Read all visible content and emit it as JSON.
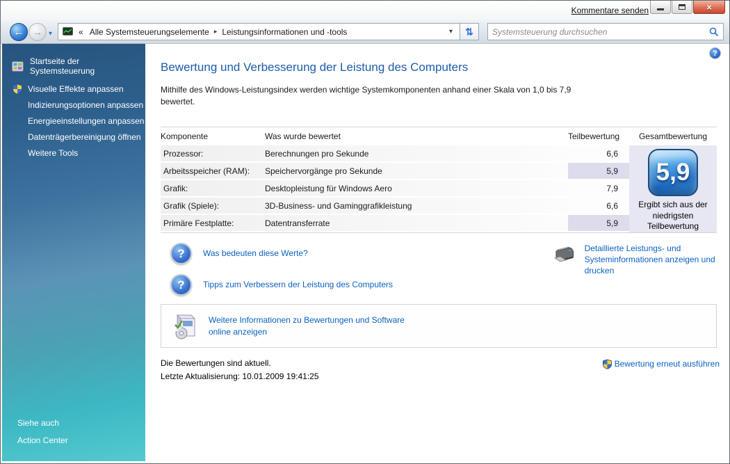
{
  "window": {
    "feedback_link": "Kommentare senden"
  },
  "icons": {
    "back_arrow": "←",
    "forward_arrow": "→",
    "dropdown_caret": "▾",
    "breadcrumb_overflow": "«",
    "breadcrumb_separator": "▸",
    "refresh": "⇄",
    "question_mark": "?",
    "close": "×",
    "search_caret": "▾"
  },
  "navbar": {
    "breadcrumb_items": [
      "Alle Systemsteuerungselemente",
      "Leistungsinformationen und -tools"
    ],
    "search_placeholder": "Systemsteuerung durchsuchen"
  },
  "sidebar": {
    "home_label": "Startseite der Systemsteuerung",
    "tasks": [
      "Visuelle Effekte anpassen",
      "Indizierungsoptionen anpassen",
      "Energieeinstellungen anpassen",
      "Datenträgerbereinigung öffnen",
      "Weitere Tools"
    ],
    "see_also_header": "Siehe auch",
    "see_also_link": "Action Center"
  },
  "main": {
    "title": "Bewertung und Verbesserung der Leistung des Computers",
    "intro": "Mithilfe des Windows-Leistungsindex werden wichtige Systemkomponenten anhand einer Skala von 1,0 bis 7,9 bewertet.",
    "table": {
      "headers": [
        "Komponente",
        "Was wurde bewertet",
        "Teilbewertung",
        "Gesamtbewertung"
      ],
      "rows": [
        {
          "component": "Prozessor:",
          "assessed": "Berechnungen pro Sekunde",
          "score": "6,6",
          "lowest": false
        },
        {
          "component": "Arbeitsspeicher (RAM):",
          "assessed": "Speichervorgänge pro Sekunde",
          "score": "5,9",
          "lowest": true
        },
        {
          "component": "Grafik:",
          "assessed": "Desktopleistung für Windows Aero",
          "score": "7,9",
          "lowest": false
        },
        {
          "component": "Grafik (Spiele):",
          "assessed": "3D-Business- und Gaminggrafikleistung",
          "score": "6,6",
          "lowest": false
        },
        {
          "component": "Primäre Festplatte:",
          "assessed": "Datentransferrate",
          "score": "5,9",
          "lowest": true
        }
      ],
      "base_score": "5,9",
      "base_score_caption": "Ergibt sich aus der niedrigsten Teilbewertung"
    },
    "links": {
      "what_values_mean": "Was bedeuten diese Werte?",
      "tips": "Tipps zum Verbessern der Leistung des Computers",
      "print_details": "Detaillierte Leistungs- und Systeminformationen anzeigen und drucken",
      "online_info": "Weitere Informationen zu Bewertungen und Software online anzeigen",
      "rerun": "Bewertung erneut ausführen"
    },
    "status": {
      "line1": "Die Bewertungen sind aktuell.",
      "line2": "Letzte Aktualisierung: 10.01.2009 19:41:25"
    }
  },
  "colors": {
    "link_blue": "#0b61c2",
    "heading_blue": "#1d5ca8",
    "score_highlight": "#dcdcec",
    "total_panel_bg": "#e7e7f4",
    "badge_blue": "#2a7fd0",
    "sidebar_top": "#27547f",
    "sidebar_bottom": "#55cacd",
    "close_button_red": "#c94730"
  }
}
